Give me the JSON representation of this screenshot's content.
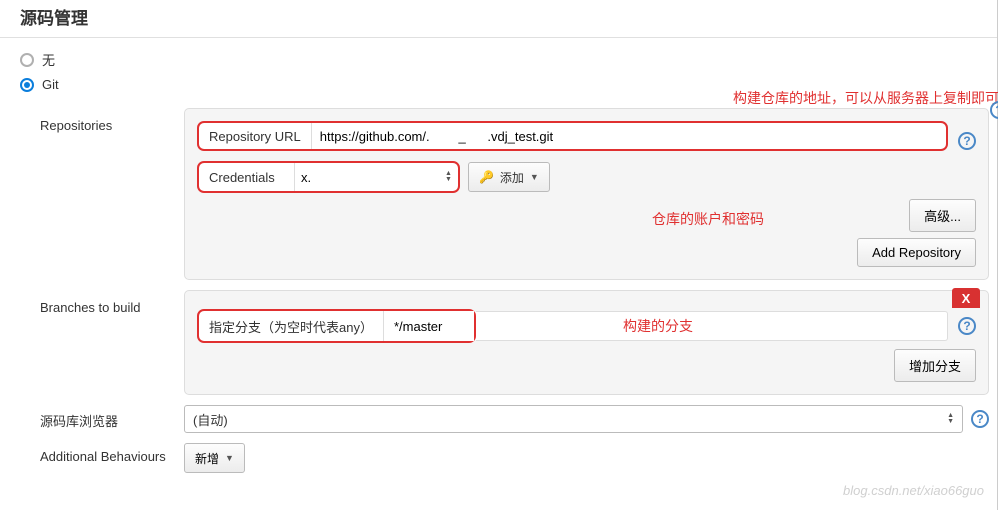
{
  "section_title": "源码管理",
  "radios": {
    "none": "无",
    "git": "Git"
  },
  "repositories": {
    "label": "Repositories",
    "url_label": "Repository URL",
    "url_value": "https://github.com/.        _      .vdj_test.git",
    "cred_label": "Credentials",
    "cred_value": "x.",
    "add_label": "添加",
    "advanced": "高级...",
    "add_repo": "Add Repository",
    "annot_url": "构建仓库的地址，可以从服务器上复制即可",
    "annot_cred": "仓库的账户和密码"
  },
  "branches": {
    "label": "Branches to build",
    "spec_label": "指定分支（为空时代表any）",
    "spec_value": "*/master",
    "add_branch": "增加分支",
    "annot": "构建的分支",
    "delete": "X"
  },
  "browser": {
    "label": "源码库浏览器",
    "value": "(自动)"
  },
  "behaviours": {
    "label": "Additional Behaviours",
    "add": "新增"
  },
  "help": "?",
  "watermark": "blog.csdn.net/xiao66guo"
}
